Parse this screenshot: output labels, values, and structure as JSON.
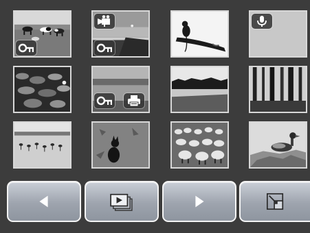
{
  "thumbnails": [
    {
      "subject": "cows-in-pasture",
      "badges": [
        "lock-icon"
      ]
    },
    {
      "subject": "sunset-over-lake",
      "badges": [
        "video-camera-icon",
        "lock-icon"
      ]
    },
    {
      "subject": "monkey-on-branch",
      "badges": []
    },
    {
      "subject": "voice-memo-blank",
      "badges": [
        "microphone-icon"
      ]
    },
    {
      "subject": "lily-pads",
      "badges": []
    },
    {
      "subject": "lakeside-landscape",
      "badges": [
        "lock-icon",
        "printer-icon"
      ]
    },
    {
      "subject": "lake-with-trees",
      "badges": []
    },
    {
      "subject": "forest-trees",
      "badges": []
    },
    {
      "subject": "flamingos-in-water",
      "badges": []
    },
    {
      "subject": "fox-in-grass",
      "badges": []
    },
    {
      "subject": "sheep-flock",
      "badges": []
    },
    {
      "subject": "duck-on-rocks",
      "badges": []
    }
  ],
  "toolbar": {
    "buttons": [
      {
        "name": "previous-button",
        "icon": "triangle-left-icon"
      },
      {
        "name": "slideshow-button",
        "icon": "slideshow-icon"
      },
      {
        "name": "next-button",
        "icon": "triangle-right-icon"
      },
      {
        "name": "zoom-button",
        "icon": "zoom-corner-icon"
      }
    ]
  },
  "colors": {
    "background": "#3c3c3c",
    "thumbnail_border": "#d8d8d8",
    "button_face": "#a8aeb7",
    "button_border": "#f4f4f4",
    "badge_bg": "#373737"
  }
}
